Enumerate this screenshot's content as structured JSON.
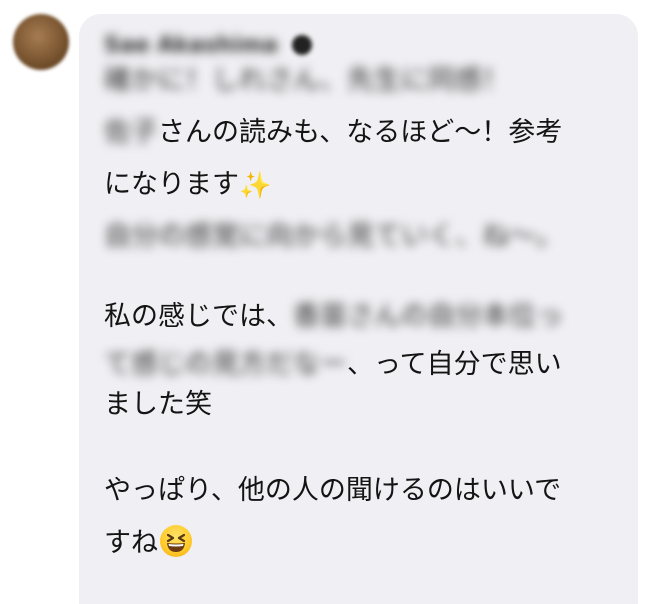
{
  "comment": {
    "author_name": "Sae Akashima",
    "lines": {
      "l1": "確かに！しれさん、先生に同感！",
      "l2_blur": "佐子",
      "l2_text": "さんの読みも、なるほど〜！参考",
      "l3_text": "になります",
      "l4": "自分の感覚に向から見ていく、ね〜。",
      "l5_text": "私の感じでは、",
      "l5_blur": "香苗さんの自分本位っ",
      "l6_blur": "て感じの見方だなー",
      "l6_text": "、って自分で思い",
      "l7": "ました笑",
      "l8": "やっぱり、他の人の聞けるのはいいで",
      "l9": "すね"
    }
  },
  "icons": {
    "avatar": "user-avatar",
    "verified": "verified-badge-icon",
    "sparkles": "sparkles-emoji",
    "grin": "grinning-squinting-face-emoji"
  },
  "colors": {
    "bubble": "#f0f0f4",
    "text": "#141414",
    "sparkles": "#f2b21c",
    "emoji_face": "#ffc928"
  }
}
